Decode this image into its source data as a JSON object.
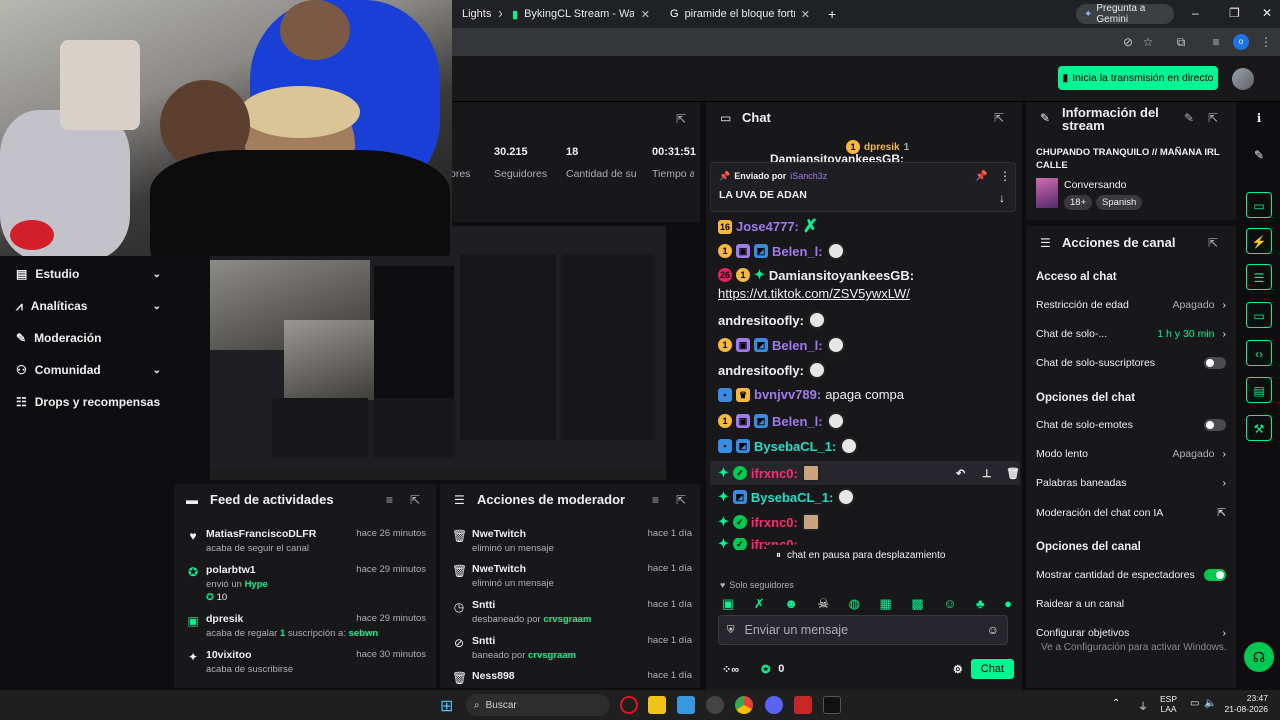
{
  "browser": {
    "tabs": [
      {
        "title": "Lights",
        "favicon": "tab-icon"
      },
      {
        "title": "BykingCL Stream - Watch L",
        "favicon": "twitch-icon"
      },
      {
        "title": "piramide el bloque fortnite - G",
        "favicon": "google-icon"
      }
    ],
    "gemini_label": "Pregunta a Gemini"
  },
  "topbar": {
    "go_live_label": "Inicia la transmisión en directo"
  },
  "nav": {
    "items": [
      {
        "label": "Estudio",
        "icon": "studio-icon",
        "has_chevron": true
      },
      {
        "label": "Analíticas",
        "icon": "analytics-icon",
        "has_chevron": true
      },
      {
        "label": "Moderación",
        "icon": "wrench-icon",
        "has_chevron": false
      },
      {
        "label": "Comunidad",
        "icon": "community-icon",
        "has_chevron": true
      },
      {
        "label": "Drops y recompensas",
        "icon": "gift-icon",
        "has_chevron": false
      }
    ]
  },
  "stats": {
    "items": [
      {
        "value": "",
        "label": "ores"
      },
      {
        "value": "30.215",
        "label": "Seguidores"
      },
      {
        "value": "18",
        "label": "Cantidad de suscripciones"
      },
      {
        "value": "00:31:51",
        "label": "Tiempo activo"
      }
    ]
  },
  "activity_feed": {
    "title": "Feed de actividades",
    "items": [
      {
        "name": "MatiasFranciscoDLFR",
        "time": "hace 26 minutos",
        "desc": "acaba de seguir el canal",
        "icon": "heart-icon"
      },
      {
        "name": "polarbtw1",
        "time": "hace 29 minutos",
        "desc": "envió un",
        "highlight": "Hype",
        "extra": "10",
        "icon": "hype-icon"
      },
      {
        "name": "dpresik",
        "time": "hace 29 minutos",
        "desc": "acaba de regalar",
        "highlight": "1",
        "desc2": "suscripción a:",
        "target": "sebwn",
        "icon": "gift-icon"
      },
      {
        "name": "10vixitoo",
        "time": "hace 30 minutos",
        "desc": "acaba de suscribirse",
        "icon": "sparkle-icon"
      }
    ]
  },
  "mod_actions": {
    "title": "Acciones de moderador",
    "items": [
      {
        "name": "NweTwitch",
        "time": "hace 1 día",
        "desc": "eliminó un mensaje",
        "icon": "trash-icon"
      },
      {
        "name": "NweTwitch",
        "time": "hace 1 día",
        "desc": "eliminó un mensaje",
        "icon": "trash-icon"
      },
      {
        "name": "Sntti",
        "time": "hace 1 día",
        "desc": "desbaneado por",
        "by": "crvsgraam",
        "icon": "clock-icon"
      },
      {
        "name": "Sntti",
        "time": "hace 1 día",
        "desc": "baneado por",
        "by": "crvsgraam",
        "icon": "ban-icon"
      },
      {
        "name": "Ness898",
        "time": "hace 1 día",
        "desc": "",
        "icon": "trash-icon"
      }
    ]
  },
  "chat": {
    "title": "Chat",
    "top_gifter": "dpresik",
    "top_gifter_count": "1",
    "partial_top": "DamiansitoyankeesGB:",
    "pinned": {
      "by_label": "Enviado por",
      "by_user": "iSanch3z",
      "message": "LA UVA DE ADAN"
    },
    "messages": [
      {
        "user": "Jose4777:",
        "color": "#9f7aea",
        "text": "",
        "badge": "16"
      },
      {
        "user": "Belen_l:",
        "color": "#9f7aea",
        "text": ""
      },
      {
        "user": "DamiansitoyankeesGB:",
        "color": "#efeff1",
        "text": "https://vt.tiktok.com/ZSV5ywxLW/"
      },
      {
        "user": "andresitoofly:",
        "color": "#efeff1",
        "text": ""
      },
      {
        "user": "Belen_l:",
        "color": "#9f7aea",
        "text": ""
      },
      {
        "user": "andresitoofly:",
        "color": "#efeff1",
        "text": ""
      },
      {
        "user": "bvnjvv789:",
        "color": "#9f7aea",
        "text": "apaga compa"
      },
      {
        "user": "Belen_l:",
        "color": "#9f7aea",
        "text": ""
      },
      {
        "user": "BysebaCL_1:",
        "color": "#1fe0c8",
        "text": ""
      },
      {
        "user": "ifrxnc0:",
        "color": "#ff2a6d",
        "text": ""
      },
      {
        "user": "BysebaCL_1:",
        "color": "#1fe0c8",
        "text": ""
      },
      {
        "user": "ifrxnc0:",
        "color": "#ff2a6d",
        "text": ""
      },
      {
        "user": "ifrxnc0:",
        "color": "#ff2a6d",
        "text": ""
      }
    ],
    "paused_label": "chat en pausa para desplazamiento",
    "followers_only": "Solo seguidores",
    "input_placeholder": "Enviar un mensaje",
    "points": "0",
    "send_label": "Chat"
  },
  "stream_info": {
    "title": "Información del stream",
    "stream_title": "CHUPANDO TRANQUILO // MAÑANA IRL CALLE",
    "category": "Conversando",
    "tags": [
      "18+",
      "Spanish"
    ]
  },
  "channel_actions": {
    "title": "Acciones de canal",
    "chat_access_header": "Acceso al chat",
    "age_restriction": {
      "label": "Restricción de edad",
      "value": "Apagado"
    },
    "followers_only": {
      "label": "Chat de solo-...",
      "value": "1 h y 30 min"
    },
    "subs_only_label": "Chat de solo-suscriptores",
    "chat_options_header": "Opciones del chat",
    "emote_only_label": "Chat de solo-emotes",
    "slow_mode": {
      "label": "Modo lento",
      "value": "Apagado"
    },
    "banned_words_label": "Palabras baneadas",
    "ai_mod_label": "Moderación del chat con IA",
    "channel_options_header": "Opciones del canal",
    "show_viewers_label": "Mostrar cantidad de espectadores",
    "raid_label": "Raidear a un canal",
    "goals_label": "Configurar objetivos",
    "activate_windows": "Ve a Configuración para activar Windows."
  },
  "taskbar": {
    "search_placeholder": "Buscar",
    "lang": "ESP",
    "lang2": "LAA",
    "time": "23:47",
    "date": "21-08-2026"
  },
  "colors": {
    "accent": "#00f593",
    "panel": "#18181b",
    "bg": "#0e0e10"
  }
}
